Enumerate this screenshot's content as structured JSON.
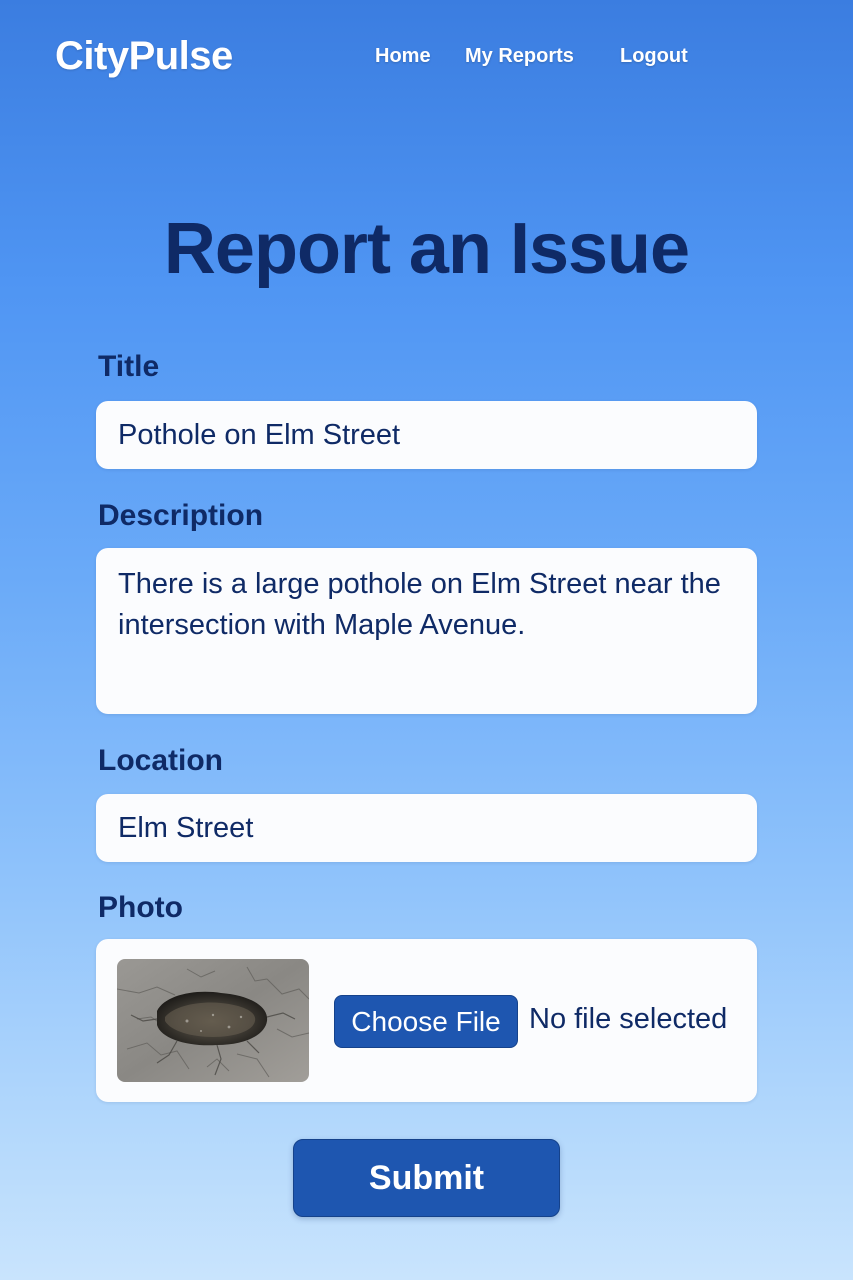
{
  "header": {
    "brand": "CityPulse",
    "nav": {
      "home": "Home",
      "my_reports": "My Reports",
      "logout": "Logout"
    }
  },
  "page": {
    "title": "Report an Issue"
  },
  "form": {
    "title": {
      "label": "Title",
      "value": "Pothole on Elm Street"
    },
    "description": {
      "label": "Description",
      "value": "There is a large pothole on Elm Street near the intersection with Maple Avenue."
    },
    "location": {
      "label": "Location",
      "value": "Elm Street"
    },
    "photo": {
      "label": "Photo",
      "preview": "pothole-photo",
      "choose_button": "Choose File",
      "status": "No file selected"
    },
    "submit_label": "Submit"
  },
  "colors": {
    "primary_button": "#1e56b0",
    "heading": "#0f2a66",
    "field_bg": "#fbfcfe"
  }
}
